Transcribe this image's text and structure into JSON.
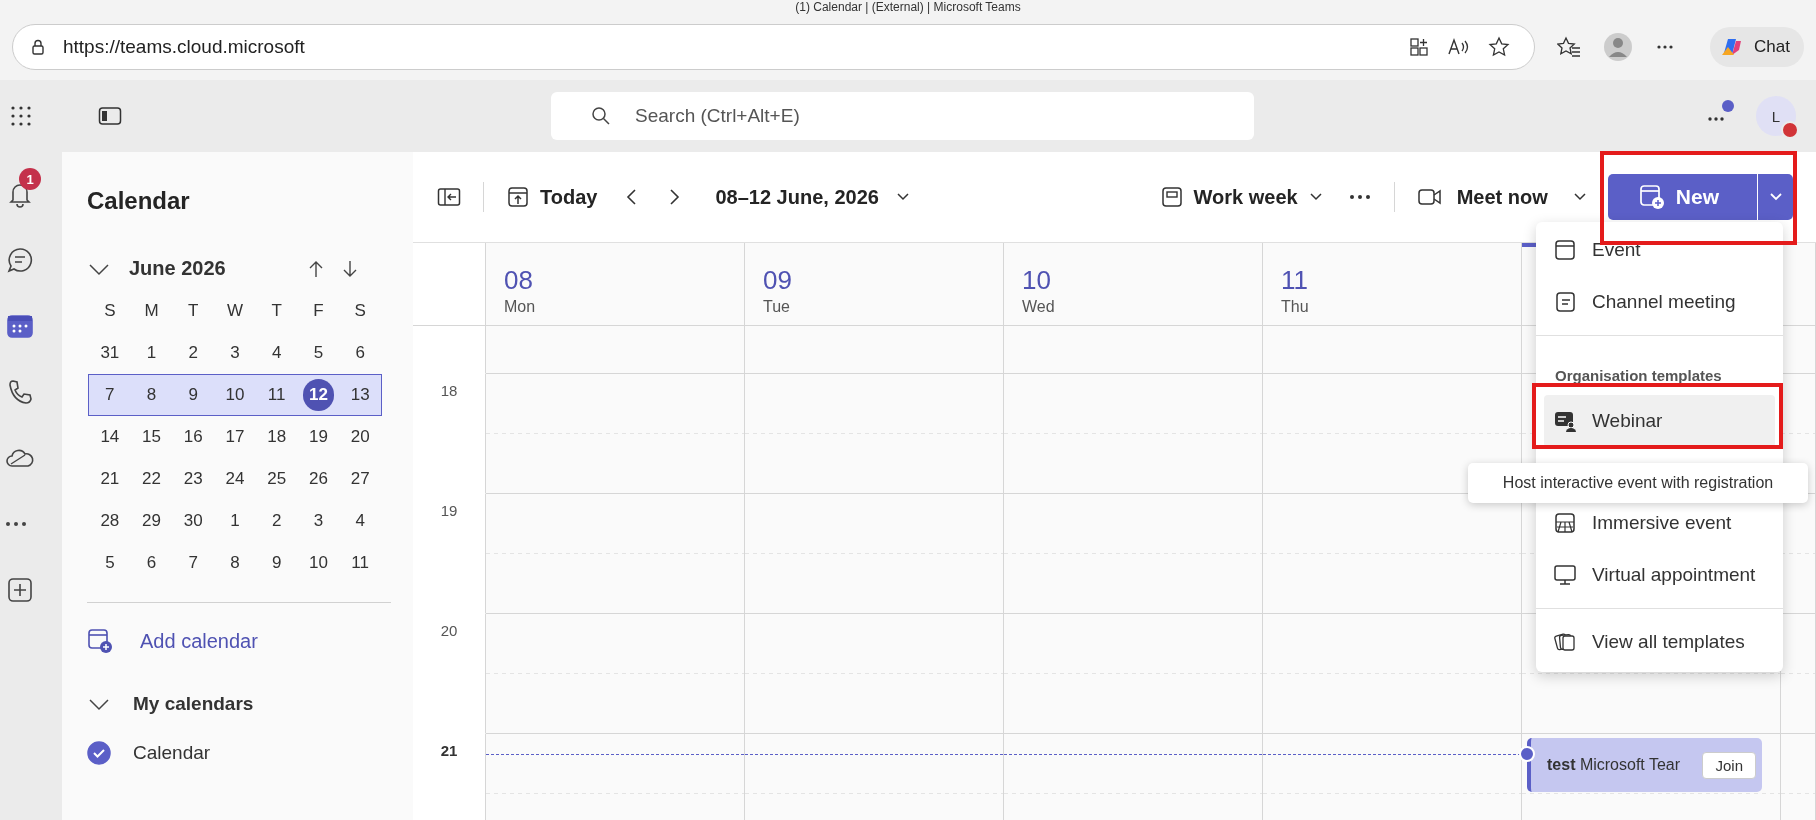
{
  "browser": {
    "title": "(1) Calendar | (External) | Microsoft Teams",
    "url": "https://teams.cloud.microsoft",
    "chat_label": "Chat"
  },
  "topbar": {
    "search_placeholder": "Search (Ctrl+Alt+E)",
    "avatar": "L"
  },
  "rail": [
    {
      "badge": "1",
      "selected": false
    },
    {
      "selected": false
    },
    {
      "selected": true
    },
    {
      "selected": false
    },
    {
      "selected": false
    },
    {
      "selected": false
    },
    {
      "selected": false
    }
  ],
  "sidebar": {
    "title": "Calendar",
    "month": "June 2026",
    "month_expanded": true,
    "weekdays": [
      "S",
      "M",
      "T",
      "W",
      "T",
      "F",
      "S"
    ],
    "weeks": [
      {
        "selected": false,
        "days": [
          {
            "label": "31",
            "today": false
          },
          {
            "label": "1",
            "today": false
          },
          {
            "label": "2",
            "today": false
          },
          {
            "label": "3",
            "today": false
          },
          {
            "label": "4",
            "today": false
          },
          {
            "label": "5",
            "today": false
          },
          {
            "label": "6",
            "today": false
          }
        ]
      },
      {
        "selected": true,
        "days": [
          {
            "label": "7",
            "today": false
          },
          {
            "label": "8",
            "today": false
          },
          {
            "label": "9",
            "today": false
          },
          {
            "label": "10",
            "today": false
          },
          {
            "label": "11",
            "today": false
          },
          {
            "label": "12",
            "today": true
          },
          {
            "label": "13",
            "today": false
          }
        ]
      },
      {
        "selected": false,
        "days": [
          {
            "label": "14",
            "today": false
          },
          {
            "label": "15",
            "today": false
          },
          {
            "label": "16",
            "today": false
          },
          {
            "label": "17",
            "today": false
          },
          {
            "label": "18",
            "today": false
          },
          {
            "label": "19",
            "today": false
          },
          {
            "label": "20",
            "today": false
          }
        ]
      },
      {
        "selected": false,
        "days": [
          {
            "label": "21",
            "today": false
          },
          {
            "label": "22",
            "today": false
          },
          {
            "label": "23",
            "today": false
          },
          {
            "label": "24",
            "today": false
          },
          {
            "label": "25",
            "today": false
          },
          {
            "label": "26",
            "today": false
          },
          {
            "label": "27",
            "today": false
          }
        ]
      },
      {
        "selected": false,
        "days": [
          {
            "label": "28",
            "today": false
          },
          {
            "label": "29",
            "today": false
          },
          {
            "label": "30",
            "today": false
          },
          {
            "label": "1",
            "today": false
          },
          {
            "label": "2",
            "today": false
          },
          {
            "label": "3",
            "today": false
          },
          {
            "label": "4",
            "today": false
          }
        ]
      },
      {
        "selected": false,
        "days": [
          {
            "label": "5",
            "today": false
          },
          {
            "label": "6",
            "today": false
          },
          {
            "label": "7",
            "today": false
          },
          {
            "label": "8",
            "today": false
          },
          {
            "label": "9",
            "today": false
          },
          {
            "label": "10",
            "today": false
          },
          {
            "label": "11",
            "today": false
          }
        ]
      }
    ],
    "add_calendar": "Add calendar",
    "my_calendars": "My calendars",
    "my_calendars_expanded": true,
    "calendars": [
      {
        "name": "Calendar",
        "checked": true
      }
    ]
  },
  "toolbar": {
    "today": "Today",
    "range": "08–12 June, 2026",
    "view": "Work week",
    "meet_now": "Meet now",
    "new": "New"
  },
  "days": [
    {
      "number": "08",
      "name": "Mon"
    },
    {
      "number": "09",
      "name": "Tue"
    },
    {
      "number": "10",
      "name": "Wed"
    },
    {
      "number": "11",
      "name": "Thu"
    }
  ],
  "hours": [
    {
      "label": "18",
      "current": false
    },
    {
      "label": "19",
      "current": false
    },
    {
      "label": "20",
      "current": false
    },
    {
      "label": "21",
      "current": true
    }
  ],
  "event": {
    "title": "test",
    "organizer": "Microsoft Tear",
    "join": "Join"
  },
  "menu": [
    {
      "kind": "item",
      "label": "Event",
      "selected": false
    },
    {
      "kind": "item",
      "label": "Channel meeting",
      "selected": false
    },
    {
      "kind": "divider"
    },
    {
      "kind": "heading",
      "label": "Organisation templates"
    },
    {
      "kind": "item",
      "label": "Webinar",
      "selected": true
    },
    {
      "kind": "spacer"
    },
    {
      "kind": "item",
      "label": "Immersive event",
      "selected": false
    },
    {
      "kind": "item",
      "label": "Virtual appointment",
      "selected": false
    },
    {
      "kind": "divider"
    },
    {
      "kind": "item",
      "label": "View all templates",
      "selected": false
    }
  ],
  "tooltip": "Host interactive event with registration"
}
